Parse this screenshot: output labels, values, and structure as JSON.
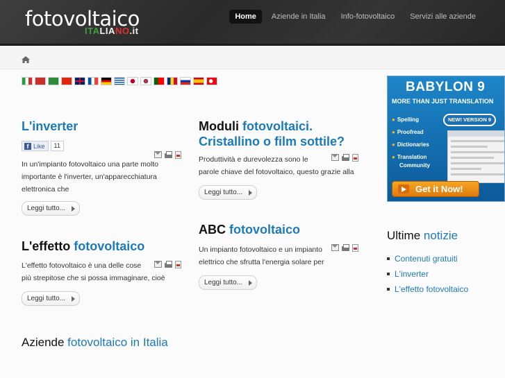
{
  "header": {
    "logo_main": "fotovoltaico",
    "logo_sub": [
      "ITA",
      "LIA",
      "NO",
      ".it"
    ],
    "nav": [
      "Home",
      "Aziende in Italia",
      "Info-fotovoltaico",
      "Servizi alle aziende"
    ]
  },
  "flags": [
    "it",
    "ar",
    "ar-2",
    "cn",
    "gb",
    "fr",
    "de",
    "gr",
    "jp",
    "kr",
    "pt",
    "ro",
    "ru",
    "es",
    "tr"
  ],
  "articles": {
    "inverter": {
      "title": "L'inverter",
      "fb_like": "Like",
      "fb_count": "11",
      "text": [
        "In un'impianto fotovoltaico una parte molto",
        "importante è l'inverter, un'apparecchiatura",
        "elettronica che"
      ],
      "button": "Leggi tutto..."
    },
    "effetto": {
      "title_dark": "L'effetto",
      "title_hl": "fotovoltaico",
      "text": [
        "L'effetto fotovoltaico è una delle cose",
        "più strepitose che si possa immaginare, cioè"
      ],
      "button": "Leggi tutto..."
    },
    "moduli": {
      "title_dark": "Moduli",
      "title_hl": "fotovoltaici.",
      "title_line2": "Cristallino o film sottile?",
      "text": [
        "Produttività e durevolezza sono le",
        "parole chiave del fotovoltaico, questo grazie alla"
      ],
      "button": "Leggi tutto..."
    },
    "abc": {
      "title_dark": "ABC",
      "title_hl": "fotovoltaico",
      "text": [
        "Un impianto fotovoltaico e un impianto",
        "elettrico che sfrutta l'energia solare per"
      ],
      "button": "Leggi tutto..."
    }
  },
  "ad": {
    "title": "BABYLON 9",
    "subtitle": "MORE THAN JUST TRANSLATION",
    "features": [
      "Spelling",
      "Proofread",
      "Dictionaries",
      "Translation",
      "Community"
    ],
    "badge": "NEW! VERSION 9",
    "cta": "Get it Now!"
  },
  "sidebar": {
    "heading_dark": "Ultime",
    "heading_hl": "notizie",
    "items": [
      "Contenuti gratuiti",
      "L'inverter",
      "L'effetto fotovoltaico"
    ]
  },
  "bottom": {
    "heading_dark": "Aziende",
    "heading_hl": "fotovoltaico in Italia"
  }
}
